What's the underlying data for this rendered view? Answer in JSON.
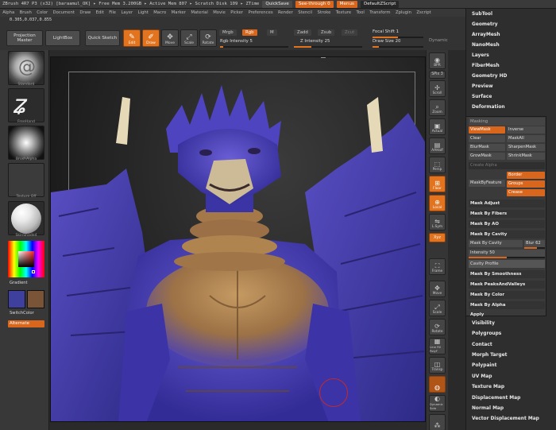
{
  "app": {
    "title": "ZBrush 4R7 P3 (x32)   [baraamul_OK]   ▸ Free Mem 3.200GB ▸ Active Mem 807 ▸ Scratch Disk 109 ▸ ZTime",
    "quicksave": "QuickSave",
    "seethrough": "See-through  0",
    "menus": "Menus",
    "script": "DefaultZScript"
  },
  "menubar": [
    "Alpha",
    "Brush",
    "Color",
    "Document",
    "Draw",
    "Edit",
    "File",
    "Layer",
    "Light",
    "Macro",
    "Marker",
    "Material",
    "Movie",
    "Picker",
    "Preferences",
    "Render",
    "Stencil",
    "Stroke",
    "Texture",
    "Tool",
    "Transform",
    "Zplugin",
    "Zscript"
  ],
  "coords": "0.305,0.037,0.855",
  "toolbar": {
    "projection_master": "Projection Master",
    "lightbox": "LightBox",
    "quick_sketch": "Quick Sketch",
    "edit": "Edit",
    "draw": "Draw",
    "move": "Move",
    "scale": "Scale",
    "rotate": "Rotate",
    "mrgb": "Mrgb",
    "rgb": "Rgb",
    "m": "M",
    "zadd": "Zadd",
    "zsub": "Zsub",
    "zcut": "Zcut",
    "rgb_intensity": "Rgb Intensity 5",
    "z_intensity": "Z Intensity 25",
    "focal_shift": "Focal Shift 1",
    "draw_size": "Draw Size 20",
    "dynamic": "Dynamic"
  },
  "left_tray": {
    "brush_label": "Standard",
    "stroke_label": "FreeHand",
    "alpha_label": "BrushAlpha",
    "texture_label": "Texture Off",
    "material_label": "SkinShade4",
    "gradient": "Gradient",
    "switch_color": "SwitchColor",
    "alternate": "Alternate",
    "main_color": "#3f3f9e",
    "secondary_color": "#7a5437"
  },
  "right_shelf": {
    "bpr": "BPR",
    "spix": "SPix 3",
    "scroll": "Scroll",
    "zoom": "Zoom",
    "actual": "Actual",
    "aahalf": "AAHalf",
    "persp": "Persp",
    "floor": "Floor",
    "local": "Local",
    "lsym": "L.Sym",
    "xyz": "Xyz",
    "frame": "Frame",
    "move": "Move",
    "scale": "Scale",
    "rotate": "Rotate",
    "linefill": "Line Fill PolyF",
    "transp": "Transp",
    "dynamic_solo": "Dynamic Solo"
  },
  "right_panel": {
    "top_items": [
      "SubTool",
      "Geometry",
      "ArrayMesh",
      "NanoMesh",
      "Layers",
      "FiberMesh",
      "Geometry HD",
      "Preview",
      "Surface",
      "Deformation"
    ],
    "bottom_items": [
      "Visibility",
      "Polygroups",
      "Contact",
      "Morph Target",
      "Polypaint",
      "UV Map",
      "Texture Map",
      "Displacement Map",
      "Normal Map",
      "Vector Displacement Map"
    ]
  },
  "masking": {
    "header": "Masking",
    "view_mask": "ViewMask",
    "inverse": "Inverse",
    "clear": "Clear",
    "mask_all": "MaskAll",
    "blur_mask": "BlurMask",
    "sharpen_mask": "SharpenMask",
    "grow_mask": "GrowMask",
    "shrink_mask": "ShrinkMask",
    "create_alpha": "Create Alpha",
    "mask_by_feature": "MaskByFeature",
    "border": "Border",
    "groups": "Groups",
    "crease": "Crease",
    "mask_adjust": "Mask Adjust",
    "mask_by_fibers": "Mask By Fibers",
    "mask_by_ao": "Mask By AO",
    "mask_by_cavity": "Mask By Cavity",
    "mask_by_cavity_btn": "Mask By Cavity",
    "blur_value": "Blur 62",
    "intensity": "Intensity 50",
    "cavity_profile": "Cavity Profile",
    "mask_by_smoothness": "Mask By Smoothness",
    "mask_peaks": "Mask PeaksAndValleys",
    "mask_by_color": "Mask By Color",
    "mask_by_alpha": "Mask By Alpha",
    "apply": "Apply",
    "intensity_level": 0.5,
    "blur_level": 0.62
  },
  "colors": {
    "accent": "#d8661c",
    "model_purple": "#4a3ea8",
    "model_tan": "#a77a4a"
  }
}
